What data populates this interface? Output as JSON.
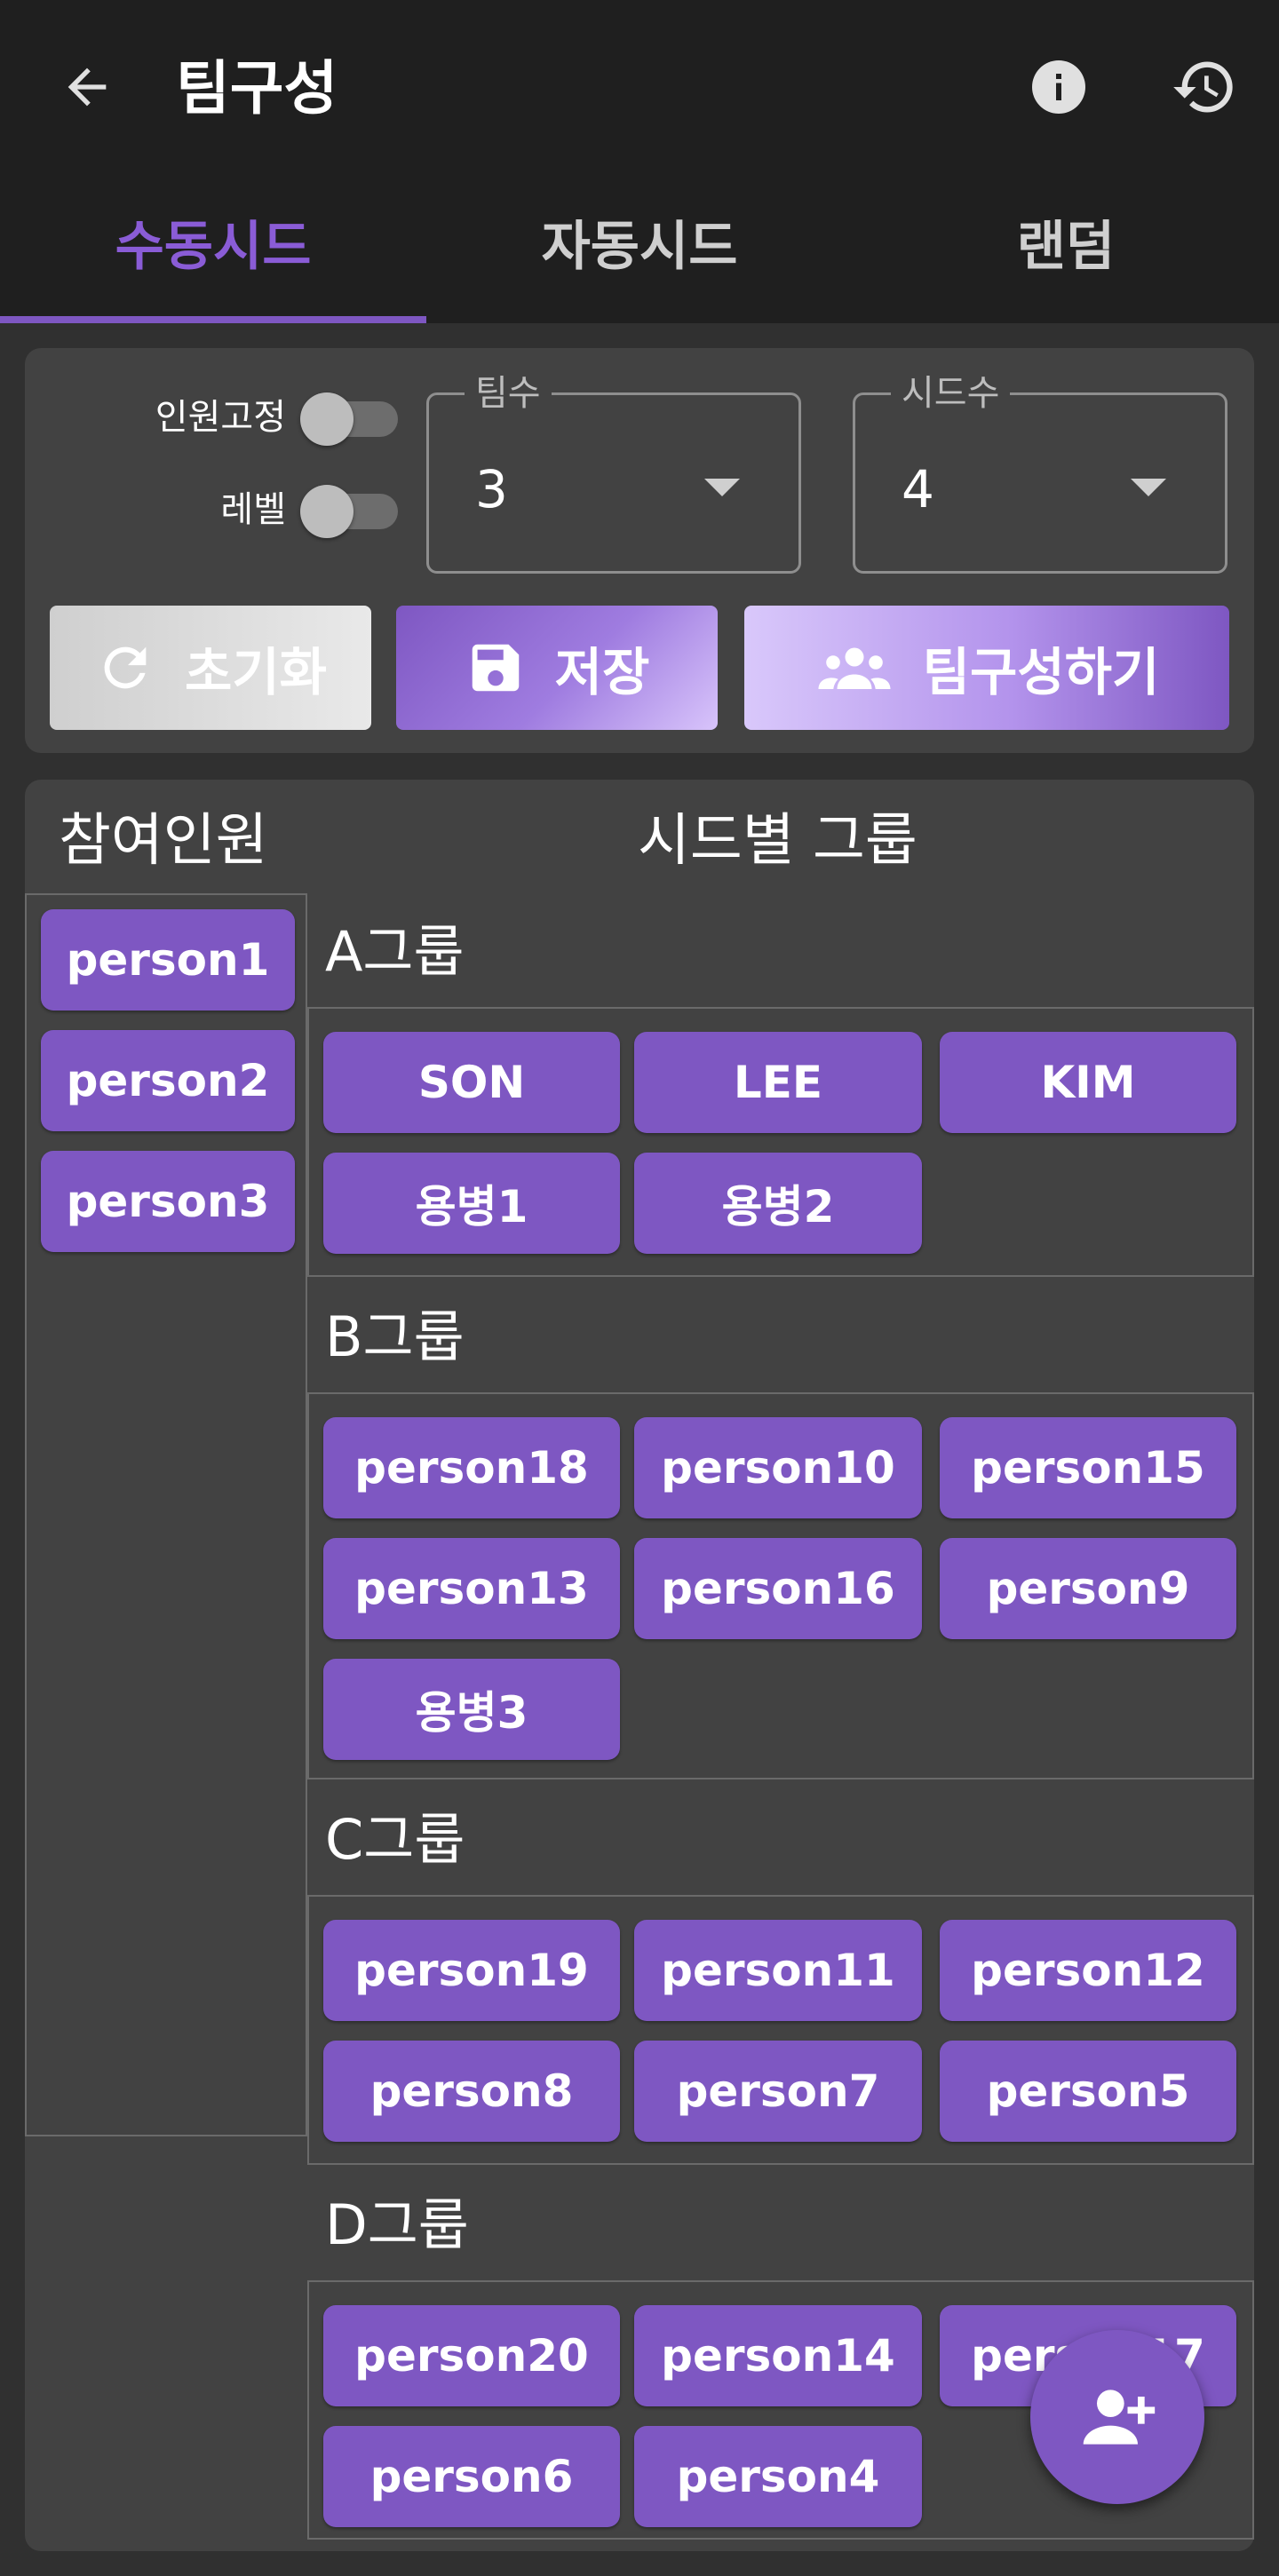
{
  "appbar": {
    "title": "팀구성",
    "back_icon": "arrow-left-icon",
    "info_icon": "info-icon",
    "history_icon": "history-icon"
  },
  "tabs": [
    {
      "label": "수동시드",
      "active": true
    },
    {
      "label": "자동시드",
      "active": false
    },
    {
      "label": "랜덤",
      "active": false
    }
  ],
  "controls": {
    "fixed_members_label": "인원고정",
    "fixed_members_on": false,
    "level_label": "레벨",
    "level_on": false,
    "team_count": {
      "legend": "팀수",
      "value": "3"
    },
    "seed_count": {
      "legend": "시드수",
      "value": "4"
    },
    "reset_label": "초기화",
    "save_label": "저장",
    "build_label": "팀구성하기"
  },
  "participants": {
    "title": "참여인원",
    "items": [
      "person1",
      "person2",
      "person3"
    ]
  },
  "groups": {
    "title": "시드별 그룹",
    "list": [
      {
        "label": "A그룹",
        "members": [
          "SON",
          "LEE",
          "KIM",
          "용병1",
          "용병2"
        ]
      },
      {
        "label": "B그룹",
        "members": [
          "person18",
          "person10",
          "person15",
          "person13",
          "person16",
          "person9",
          "용병3"
        ]
      },
      {
        "label": "C그룹",
        "members": [
          "person19",
          "person11",
          "person12",
          "person8",
          "person7",
          "person5"
        ]
      },
      {
        "label": "D그룹",
        "members": [
          "person20",
          "person14",
          "person17",
          "person6",
          "person4"
        ]
      }
    ]
  },
  "fab": {
    "icon": "add-person-icon"
  },
  "colors": {
    "accent": "#7e57c2",
    "background": "#303030",
    "card": "#424242",
    "appbar": "#1f1f1f"
  }
}
